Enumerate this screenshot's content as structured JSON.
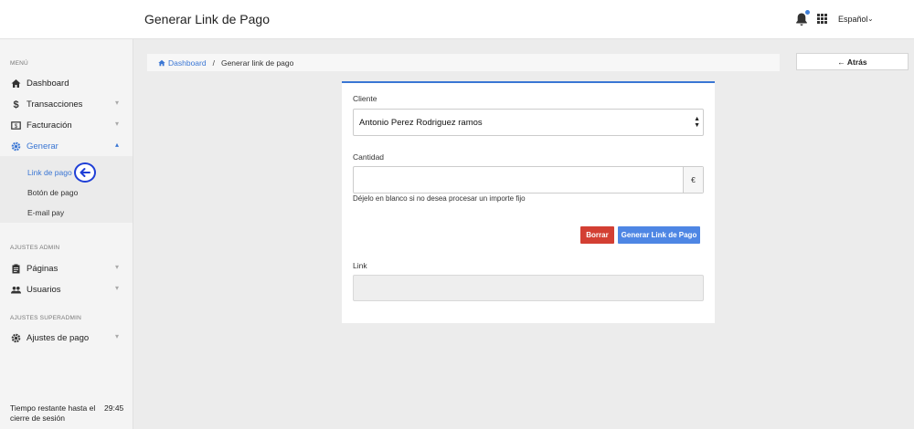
{
  "header": {
    "title": "Generar Link de Pago",
    "language": "Español"
  },
  "sidebar": {
    "menu_label": "MENÚ",
    "items": [
      {
        "label": "Dashboard"
      },
      {
        "label": "Transacciones"
      },
      {
        "label": "Facturación"
      },
      {
        "label": "Generar"
      }
    ],
    "submenu": [
      {
        "label": "Link de pago"
      },
      {
        "label": "Botón de pago"
      },
      {
        "label": "E-mail pay"
      }
    ],
    "admin_label": "AJUSTES ADMIN",
    "admin_items": [
      {
        "label": "Páginas"
      },
      {
        "label": "Usuarios"
      }
    ],
    "superadmin_label": "AJUSTES SUPERADMIN",
    "superadmin_items": [
      {
        "label": "Ajustes de pago"
      }
    ],
    "session_text": "Tiempo restante hasta el cierre de sesión",
    "session_timer": "29:45"
  },
  "breadcrumb": {
    "home": "Dashboard",
    "separator": "/",
    "current": "Generar link de pago"
  },
  "back_button": "← Atrás",
  "form": {
    "client_label": "Cliente",
    "client_value": "Antonio Perez Rodriguez ramos",
    "amount_label": "Cantidad",
    "amount_value": "",
    "currency": "€",
    "amount_hint": "Déjelo en blanco si no desea procesar un importe fijo",
    "clear_button": "Borrar",
    "generate_button": "Generar Link de Pago",
    "link_label": "Link",
    "link_value": ""
  },
  "colors": {
    "accent": "#3a76d4",
    "danger": "#d33f33",
    "primary_button": "#4e86e4",
    "annotation": "#1f3fd6"
  }
}
